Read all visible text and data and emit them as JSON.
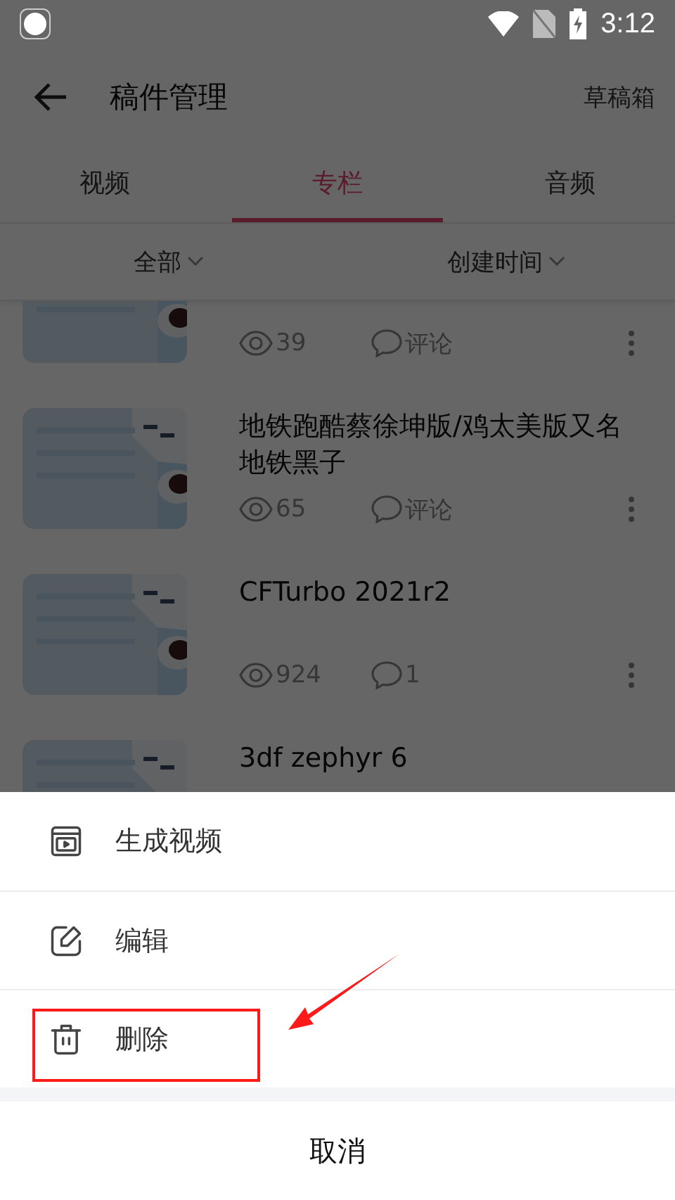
{
  "status_bar": {
    "time": "3:12"
  },
  "header": {
    "title": "稿件管理",
    "action": "草稿箱"
  },
  "tabs": [
    {
      "label": "视频",
      "selected": false
    },
    {
      "label": "专栏",
      "selected": true
    },
    {
      "label": "音频",
      "selected": false
    }
  ],
  "filters": [
    {
      "label": "全部"
    },
    {
      "label": "创建时间"
    }
  ],
  "articles": [
    {
      "views": "39",
      "comments": "评论"
    },
    {
      "title": "地铁跑酷蔡徐坤版/鸡太美版又名地铁黑子",
      "views": "65",
      "comments": "评论"
    },
    {
      "title": "CFTurbo 2021r2",
      "views": "924",
      "comments": "1"
    },
    {
      "title": "3df zephyr 6"
    }
  ],
  "sheet": {
    "actions": [
      {
        "kind": "video",
        "label": "生成视频",
        "highlighted": false
      },
      {
        "kind": "edit",
        "label": "编辑",
        "highlighted": false
      },
      {
        "kind": "delete",
        "label": "删除",
        "highlighted": true
      }
    ],
    "cancel": "取消"
  }
}
